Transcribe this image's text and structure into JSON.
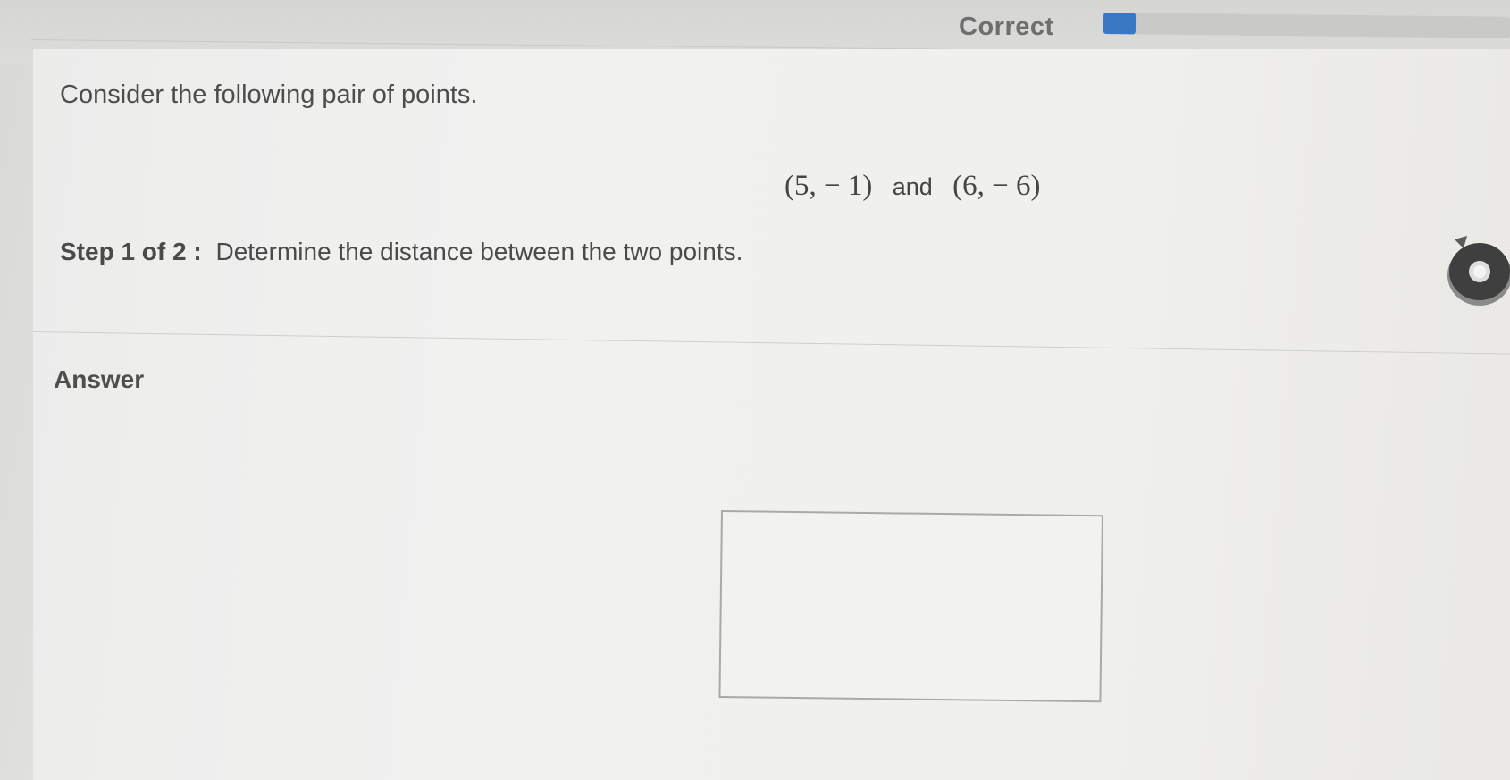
{
  "header": {
    "status_label": "Correct",
    "progress_fraction": 0.08,
    "progress_color": "#3b78c4"
  },
  "question": {
    "prompt": "Consider the following pair of points.",
    "point_a": "(5, − 1)",
    "conjunction": "and",
    "point_b": "(6, − 6)",
    "step_label": "Step 1 of 2 :",
    "step_text": "Determine the distance between the two points."
  },
  "answer": {
    "heading": "Answer",
    "value": ""
  },
  "icons": {
    "help_video": "video-help-icon"
  }
}
